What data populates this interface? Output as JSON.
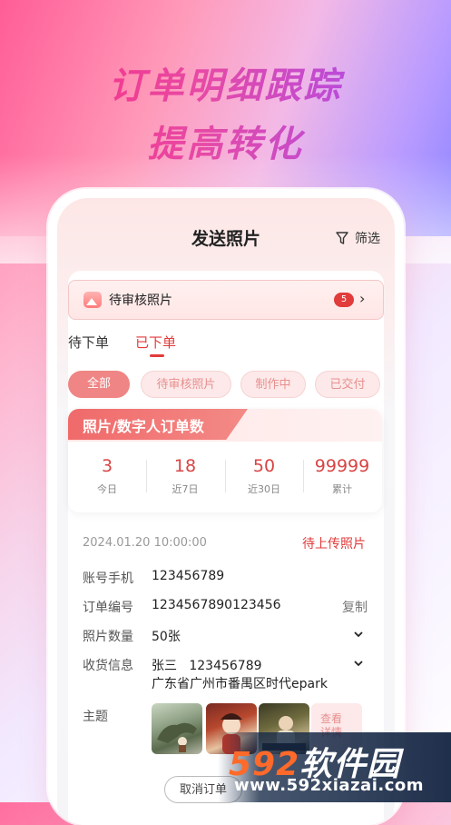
{
  "promo": {
    "headline_line1": "订单明细跟踪",
    "headline_line2": "提高转化"
  },
  "header": {
    "title": "发送照片",
    "filter_label": "筛选",
    "filter_icon": "funnel-icon"
  },
  "pending": {
    "label": "待审核照片",
    "count": "5",
    "icon": "photo-icon"
  },
  "tabs": [
    {
      "label": "待下单",
      "active": false
    },
    {
      "label": "已下单",
      "active": true
    }
  ],
  "chips": [
    {
      "label": "全部",
      "active": true
    },
    {
      "label": "待审核照片",
      "active": false
    },
    {
      "label": "制作中",
      "active": false
    },
    {
      "label": "已交付",
      "active": false
    }
  ],
  "stats": {
    "title": "照片/数字人订单数",
    "items": [
      {
        "value": "3",
        "label": "今日"
      },
      {
        "value": "18",
        "label": "近7日"
      },
      {
        "value": "50",
        "label": "近30日"
      },
      {
        "value": "99999",
        "label": "累计"
      }
    ]
  },
  "order": {
    "datetime": "2024.01.20 10:00:00",
    "status": "待上传照片",
    "account_label": "账号手机",
    "account_value": "123456789",
    "order_no_label": "订单编号",
    "order_no_value": "1234567890123456",
    "copy_label": "复制",
    "photo_count_label": "照片数量",
    "photo_count_value": "50张",
    "shipping_label": "收货信息",
    "shipping_name_phone": "张三   123456789",
    "shipping_address": "广东省广州市番禺区时代epark",
    "theme_label": "主题",
    "more_label_1": "查看",
    "more_label_2": "详情",
    "cancel_label": "取消订单"
  },
  "watermark": {
    "logo_prefix": "592",
    "logo_suffix": "软件园",
    "url": "www.592xiazai.com"
  },
  "colors": {
    "accent": "#e23b3b",
    "chip_active": "#ef8584",
    "headline_start": "#ff2a78",
    "headline_end": "#9a4cff"
  }
}
